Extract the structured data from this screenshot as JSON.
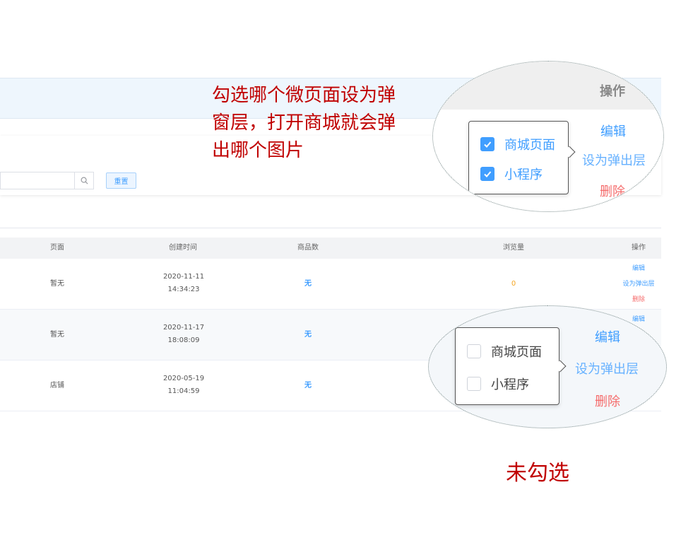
{
  "filters": {
    "search_placeholder": "",
    "reset_label": "重置"
  },
  "table": {
    "columns": {
      "page": "页面",
      "created": "创建时间",
      "goods": "商品数",
      "views": "浏览量",
      "ops": "操作"
    },
    "rows": [
      {
        "page": "暂无",
        "date": "2020-11-11",
        "time": "14:34:23",
        "goods": "无",
        "views": "0"
      },
      {
        "page": "暂无",
        "date": "2020-11-17",
        "time": "18:08:09",
        "goods": "无",
        "views": ""
      },
      {
        "page": "店铺",
        "date": "2020-05-19",
        "time": "11:04:59",
        "goods": "无",
        "views": ""
      }
    ],
    "ops": {
      "edit": "编辑",
      "set_popup": "设为弹出层",
      "delete": "删除"
    }
  },
  "annotations": {
    "note_checked": "勾选哪个微页面设为弹窗层，打开商城就会弹出哪个图片",
    "note_unchecked": "未勾选"
  },
  "zoom_checked": {
    "header": "操作",
    "edit": "编辑",
    "set_popup": "设为弹出层",
    "delete": "删除",
    "options": [
      {
        "label": "商城页面",
        "checked": true
      },
      {
        "label": "小程序",
        "checked": true
      }
    ]
  },
  "zoom_unchecked": {
    "edit": "编辑",
    "set_popup": "设为弹出层",
    "delete": "删除",
    "options": [
      {
        "label": "商城页面",
        "checked": false
      },
      {
        "label": "小程序",
        "checked": false
      }
    ]
  },
  "colors": {
    "primary": "#409eff",
    "danger": "#f56c6c",
    "warning": "#f5a623",
    "annotation": "#c00000"
  }
}
